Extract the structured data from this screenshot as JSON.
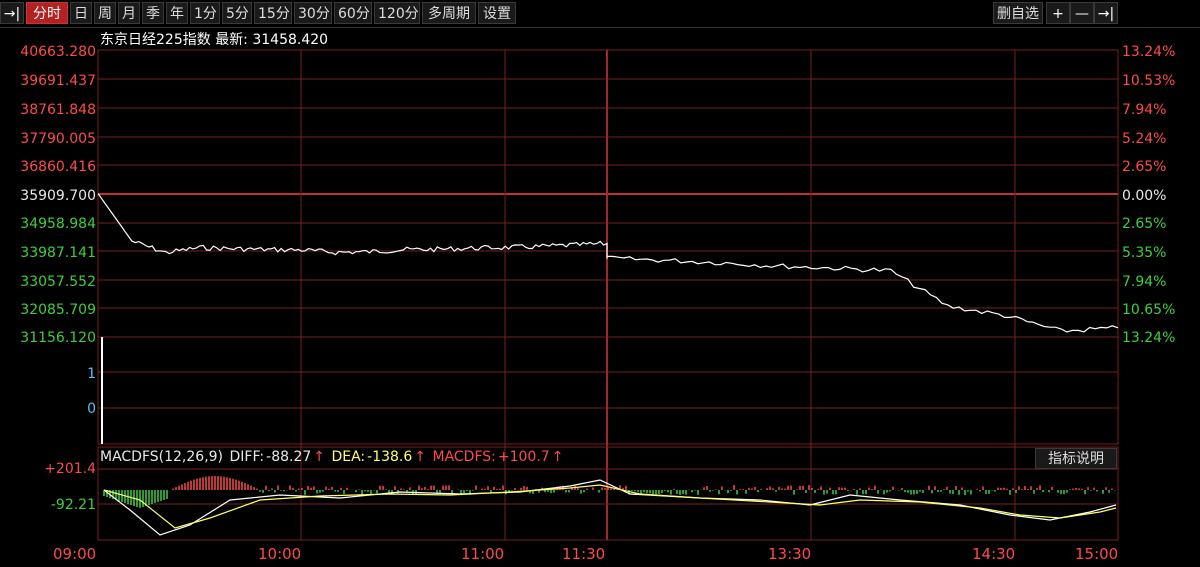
{
  "toolbar": {
    "periods": [
      "分时",
      "日",
      "周",
      "月",
      "季",
      "年",
      "1分",
      "5分",
      "15分",
      "30分",
      "60分",
      "120分",
      "多周期",
      "设置"
    ],
    "active": "分时",
    "remove_watchlist": "删自选",
    "left_icon": "→|",
    "plus": "+",
    "minus": "—",
    "right_icon": "→|"
  },
  "header": {
    "name": "东京日经225指数",
    "latest_label": "最新:",
    "latest_value": "31458.420"
  },
  "price_axis": {
    "left": [
      "40663.280",
      "39691.437",
      "38761.848",
      "37790.005",
      "36860.416",
      "35909.700",
      "34958.984",
      "33987.141",
      "33057.552",
      "32085.709",
      "31156.120"
    ],
    "right": [
      "13.24%",
      "10.53%",
      "7.94%",
      "5.24%",
      "2.65%",
      "0.00%",
      "2.65%",
      "5.35%",
      "7.94%",
      "10.65%",
      "13.24%"
    ],
    "volume_ticks": [
      "1",
      "0"
    ]
  },
  "macd": {
    "label": "MACDFS(12,26,9)",
    "diff_label": "DIFF:",
    "diff_value": "-88.27",
    "dea_label": "DEA:",
    "dea_value": "-138.6",
    "macdfs_label": "MACDFS:",
    "macdfs_value": "+100.7",
    "arrow": "↑",
    "explain_button": "指标说明",
    "axis_top": "+201.4",
    "axis_mid": "-92.21"
  },
  "time_axis": [
    "09:00",
    "10:00",
    "11:00",
    "11:30",
    "13:30",
    "14:30",
    "15:00"
  ],
  "colors": {
    "grid": "#7a1f1f",
    "up": "#ff4a4a",
    "down": "#3bd03b",
    "price_line": "#ffffff",
    "dea_line": "#ffff66"
  },
  "chart_data": {
    "type": "line",
    "x": [
      "09:00",
      "09:10",
      "09:20",
      "09:30",
      "09:40",
      "09:50",
      "10:00",
      "10:10",
      "10:20",
      "10:30",
      "10:40",
      "10:50",
      "11:00",
      "11:10",
      "11:20",
      "11:30",
      "13:30",
      "13:40",
      "13:50",
      "14:00",
      "14:10",
      "14:20",
      "14:30",
      "14:40",
      "14:50",
      "15:00"
    ],
    "series": [
      {
        "values": [
          35909,
          34330,
          33950,
          34120,
          34080,
          34050,
          34040,
          33960,
          33980,
          34050,
          34060,
          34100,
          34120,
          34150,
          34200,
          34250,
          33760,
          33700,
          33620,
          33510,
          33440,
          33350,
          32180,
          31870,
          31350,
          31460
        ]
      }
    ],
    "ylim": [
      31156.12,
      40663.28
    ],
    "grid": true
  }
}
